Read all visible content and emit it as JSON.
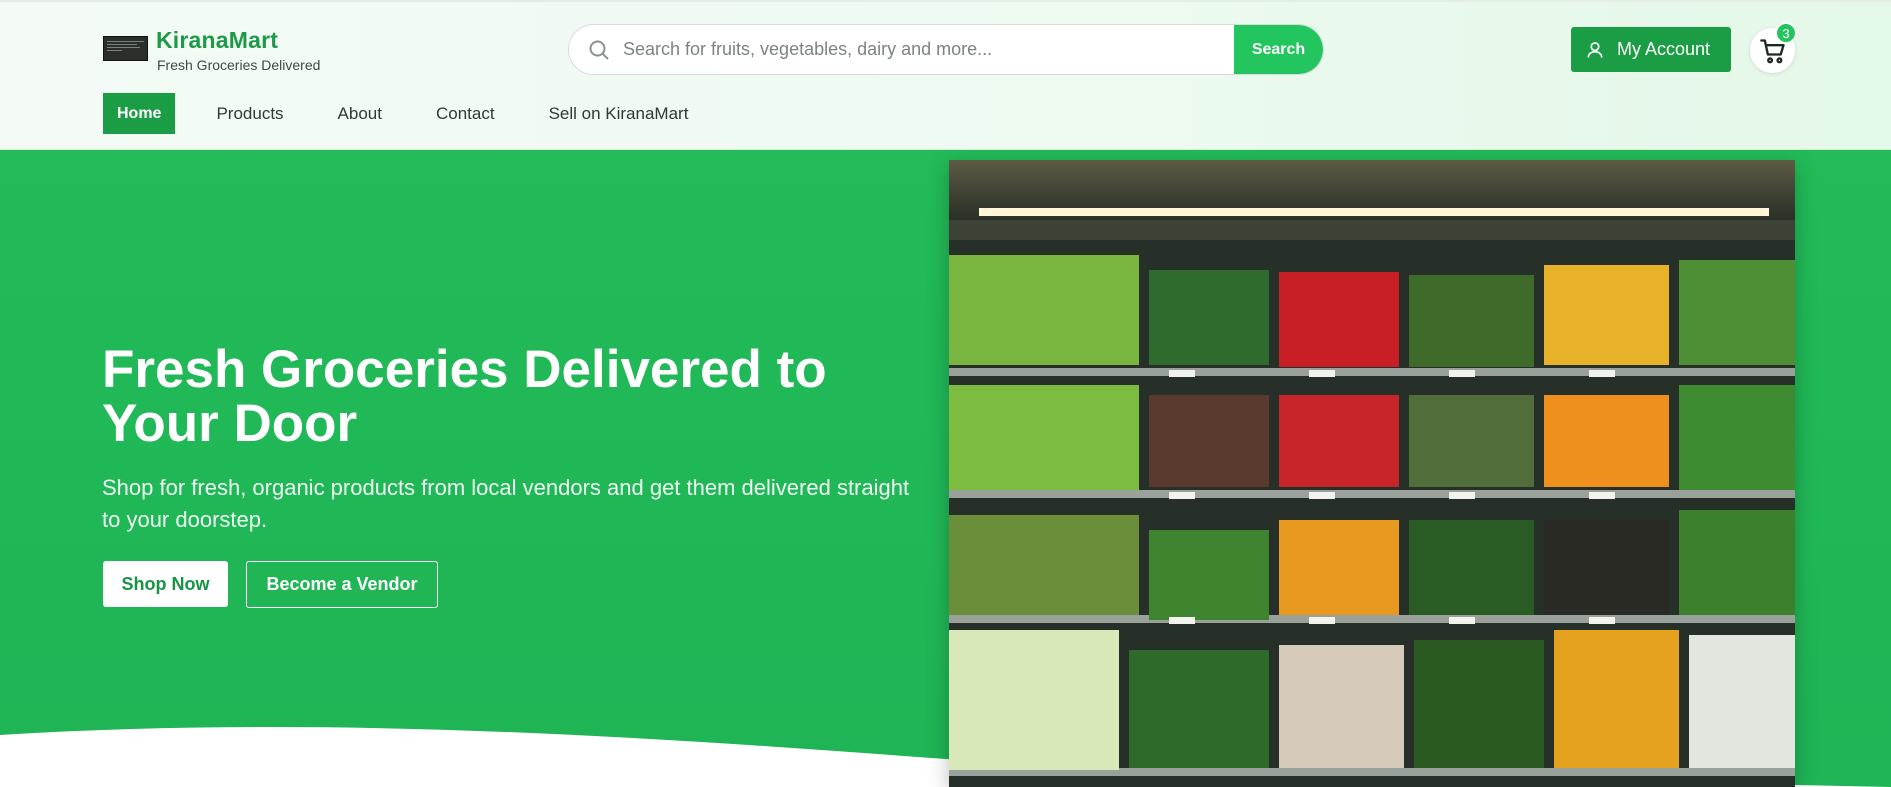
{
  "brand": {
    "name": "KiranaMart",
    "tagline": "Fresh Groceries Delivered"
  },
  "search": {
    "placeholder": "Search for fruits, vegetables, dairy and more...",
    "button_label": "Search"
  },
  "account": {
    "label": "My Account"
  },
  "cart": {
    "count": "3"
  },
  "nav": {
    "items": [
      {
        "label": "Home",
        "active": true
      },
      {
        "label": "Products",
        "active": false
      },
      {
        "label": "About",
        "active": false
      },
      {
        "label": "Contact",
        "active": false
      },
      {
        "label": "Sell on KiranaMart",
        "active": false
      }
    ]
  },
  "hero": {
    "title": "Fresh Groceries Delivered to Your Door",
    "subtitle": "Shop for fresh, organic products from local vendors and get them delivered straight to your doorstep.",
    "primary_button": "Shop Now",
    "secondary_button": "Become a Vendor",
    "image_subject": "produce-shelf-photo"
  },
  "colors": {
    "brand_green": "#1a9d45",
    "accent_green": "#22c55e",
    "hero_bg": "#22bb58",
    "nav_text": "#2f3a34"
  }
}
